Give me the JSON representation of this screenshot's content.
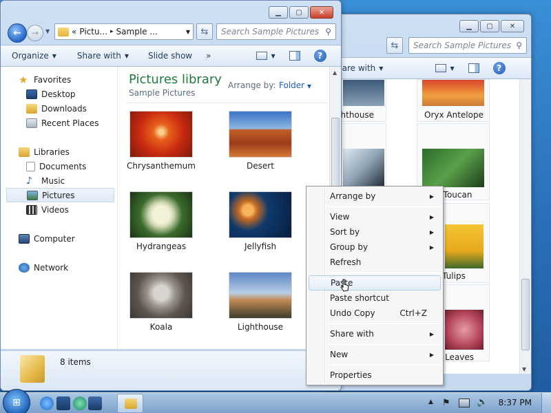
{
  "window_back": {
    "search_placeholder": "Search Sample Pictures",
    "cmd_share": "hare with",
    "items": [
      "ghthouse",
      "Oryx Antelope",
      "",
      "o Toucan",
      "Tulips",
      "er Leaves"
    ]
  },
  "window_front": {
    "address": {
      "back_chevrons": "«",
      "crumb1": "Pictu...",
      "sep": "▸",
      "crumb2": "Sample ..."
    },
    "search_placeholder": "Search Sample Pictures",
    "toolbar": {
      "organize": "Organize",
      "share_with": "Share with",
      "slide_show": "Slide show",
      "more": "»"
    },
    "nav": {
      "favorites": "Favorites",
      "desktop": "Desktop",
      "downloads": "Downloads",
      "recent_places": "Recent Places",
      "libraries": "Libraries",
      "documents": "Documents",
      "music": "Music",
      "pictures": "Pictures",
      "videos": "Videos",
      "computer": "Computer",
      "network": "Network"
    },
    "library_title": "Pictures library",
    "library_subtitle": "Sample Pictures",
    "arrange_by_label": "Arrange by:",
    "arrange_by_value": "Folder",
    "items": [
      "Chrysanthemum",
      "Desert",
      "Hydrangeas",
      "Jellyfish",
      "Koala",
      "Lighthouse"
    ],
    "status": "8 items"
  },
  "context_menu": {
    "arrange_by": "Arrange by",
    "view": "View",
    "sort_by": "Sort by",
    "group_by": "Group by",
    "refresh": "Refresh",
    "paste": "Paste",
    "paste_shortcut": "Paste shortcut",
    "undo_copy": "Undo Copy",
    "undo_shortcut": "Ctrl+Z",
    "share_with": "Share with",
    "new": "New",
    "properties": "Properties"
  },
  "taskbar": {
    "clock": "8:37 PM"
  },
  "icons": [
    "back-icon",
    "forward-icon",
    "folder-icon",
    "refresh-icon",
    "search-icon",
    "help-icon",
    "star-icon",
    "windows-logo-icon",
    "ie-icon",
    "network-icon",
    "flag-icon",
    "volume-icon"
  ]
}
